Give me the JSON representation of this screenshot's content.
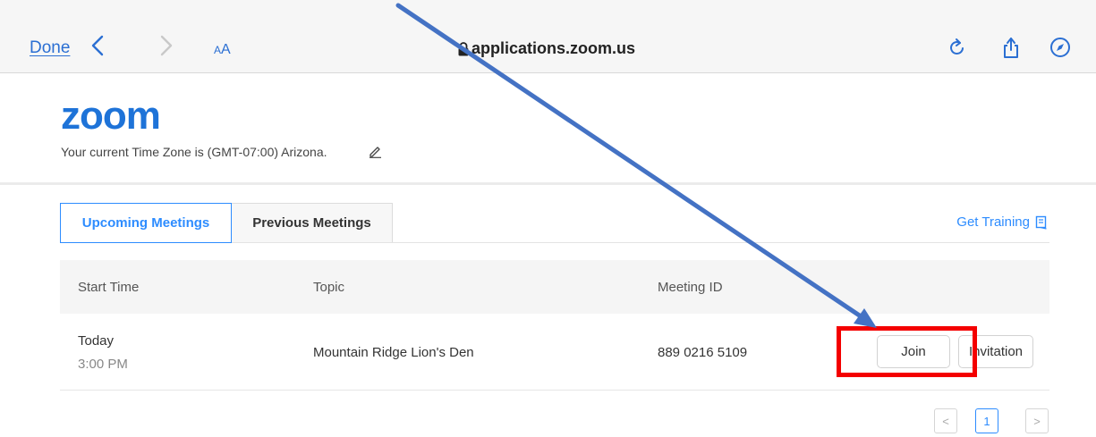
{
  "browser": {
    "done_label": "Done",
    "text_size_small": "A",
    "text_size_large": "A",
    "url": "applications.zoom.us",
    "icons": [
      "back-chevron-icon",
      "forward-chevron-icon",
      "lock-icon",
      "reload-icon",
      "share-icon",
      "compass-icon"
    ],
    "accent_color": "#2b6fd3"
  },
  "page": {
    "logo": "zoom",
    "timezone_text": "Your current Time Zone is (GMT-07:00) Arizona.",
    "tabs": [
      {
        "label": "Upcoming Meetings",
        "active": true
      },
      {
        "label": "Previous Meetings",
        "active": false
      }
    ],
    "get_training_label": "Get Training",
    "table": {
      "columns": [
        "Start Time",
        "Topic",
        "Meeting ID"
      ],
      "rows": [
        {
          "start_day": "Today",
          "start_time": "3:00 PM",
          "topic": "Mountain Ridge Lion's Den",
          "meeting_id": "889 0216 5109",
          "join_label": "Join",
          "invitation_label": "Invitation"
        }
      ]
    },
    "pagination": {
      "prev": "<",
      "current": "1",
      "next": ">"
    },
    "brand_color": "#2d8cff"
  },
  "annotation": {
    "arrow_color": "#4472c4",
    "highlight_color": "#f40000"
  }
}
